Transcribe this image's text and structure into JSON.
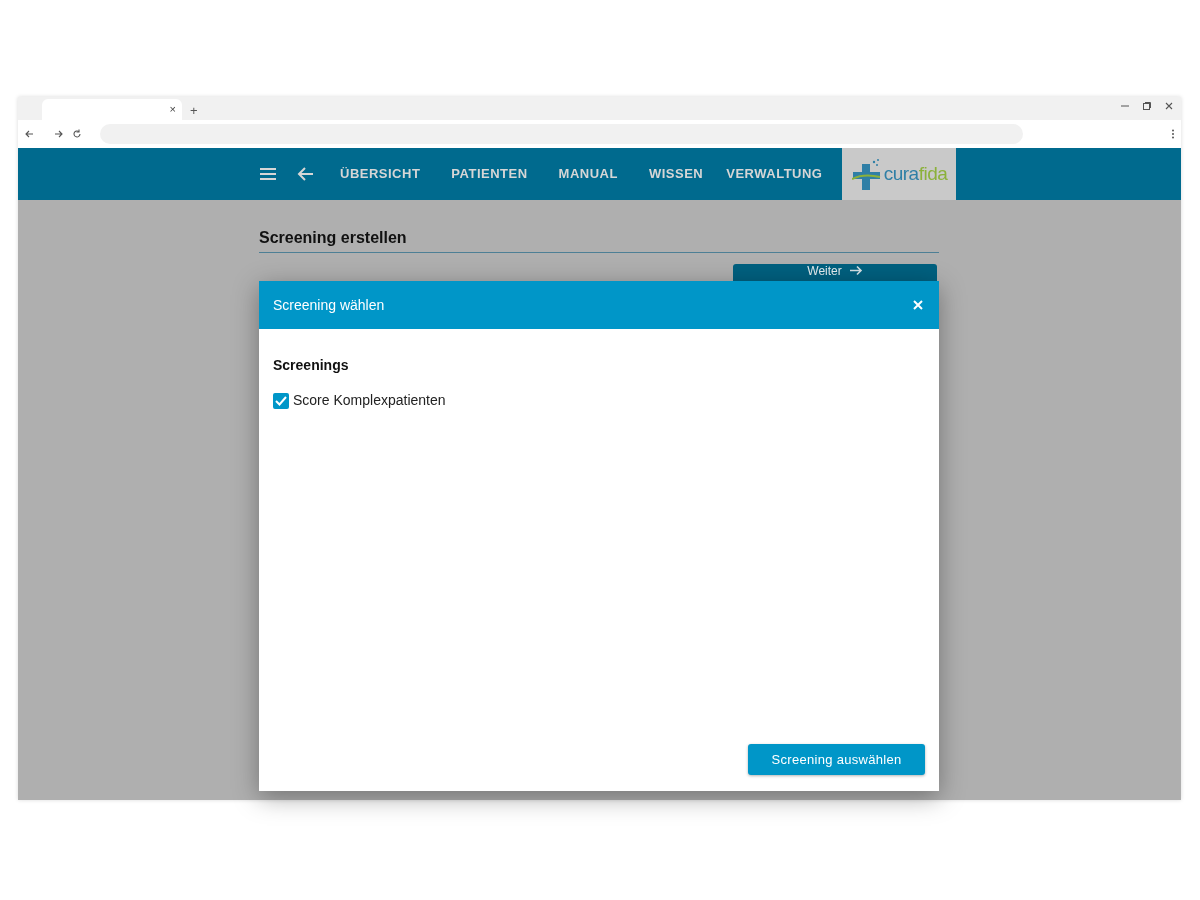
{
  "browser": {
    "tab": {
      "close": "×"
    },
    "new_tab": "+"
  },
  "navbar": {
    "items": [
      {
        "label": "ÜBERSICHT"
      },
      {
        "label": "PATIENTEN"
      },
      {
        "label": "MANUAL"
      },
      {
        "label": "WISSEN"
      },
      {
        "label": "VERWALTUNG"
      }
    ],
    "logo": {
      "wordmark": [
        "cura",
        "fida"
      ]
    }
  },
  "page": {
    "title": "Screening erstellen",
    "next_button": "Weiter"
  },
  "dialog": {
    "title": "Screening wählen",
    "section": "Screenings",
    "options": [
      {
        "label": "Score Komplexpatienten",
        "checked": true
      }
    ],
    "confirm_button": "Screening auswählen"
  }
}
